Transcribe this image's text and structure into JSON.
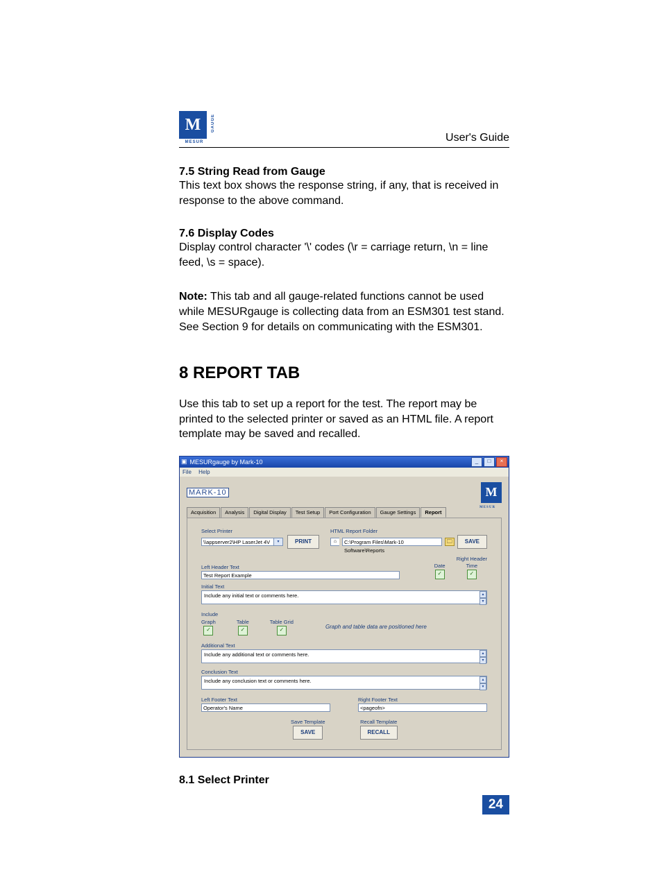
{
  "header": {
    "guide": "User's Guide",
    "logo_letter": "M",
    "logo_sub": "MESUR",
    "logo_side": "GAUGE"
  },
  "s75": {
    "head": "7.5 String Read from Gauge",
    "body": "This text box shows the response string, if any, that is received in response to the above command."
  },
  "s76": {
    "head": "7.6 Display Codes",
    "body": "Display control character '\\' codes (\\r = carriage return, \\n = line feed, \\s = space)."
  },
  "note": {
    "label": "Note:",
    "body": " This tab and all gauge-related functions cannot be used while MESURgauge is collecting data from an ESM301 test stand. See Section 9 for details on communicating with the ESM301."
  },
  "chapter": "8  REPORT TAB",
  "intro": "Use this tab to set up a report for the test. The report may be printed to the selected printer or saved as an HTML file. A report template may be saved and recalled.",
  "app": {
    "title": "MESURgauge by Mark-10",
    "menu": {
      "file": "File",
      "help": "Help"
    },
    "brand": "MARK-10",
    "tabs": [
      "Acquisition",
      "Analysis",
      "Digital Display",
      "Test Setup",
      "Port Configuration",
      "Gauge Settings",
      "Report"
    ],
    "labels": {
      "select_printer": "Select Printer",
      "html_folder": "HTML Report Folder",
      "right_header": "Right Header",
      "date": "Date",
      "time": "Time",
      "left_header": "Left Header Text",
      "initial": "Initial Text",
      "include": "Include",
      "graph": "Graph",
      "table": "Table",
      "table_grid": "Table Grid",
      "placeholder": "Graph and table data are positioned here",
      "additional": "Additional Text",
      "conclusion": "Conclusion Text",
      "left_footer": "Left Footer Text",
      "right_footer": "Right Footer Text",
      "save_template": "Save Template",
      "recall_template": "Recall Template"
    },
    "buttons": {
      "print": "PRINT",
      "save": "SAVE",
      "save2": "SAVE",
      "recall": "RECALL"
    },
    "values": {
      "printer": "\\\\appserver2\\HP LaserJet 4V",
      "html_folder": "C:\\Program Files\\Mark-10 Software\\Reports",
      "left_header": "Test Report Example",
      "initial": "Include any initial text or comments here.",
      "additional": "Include any additional text or comments here.",
      "conclusion": "Include any conclusion text or comments here.",
      "left_footer": "Operator's Name",
      "right_footer": "<pageofn>"
    }
  },
  "s81": {
    "head": "8.1 Select Printer"
  },
  "page_number": "24"
}
